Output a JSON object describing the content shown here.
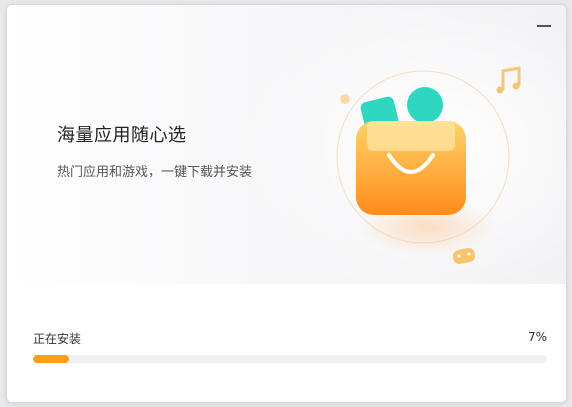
{
  "window": {
    "minimize_icon": "minimize-icon"
  },
  "hero": {
    "title": "海量应用随心选",
    "subtitle": "热门应用和游戏，一键下载并安装",
    "illustration_icons": [
      "shopping-bag-icon",
      "music-note-icon",
      "gamepad-icon"
    ]
  },
  "install": {
    "status": "正在安装",
    "percent_label": "7%",
    "progress": 0.07
  },
  "colors": {
    "accent": "#f5a017",
    "bag_top": "#ffd36a",
    "bag_bottom": "#ff8c1a",
    "teal": "#2fd6c0",
    "track": "#f0f0f2"
  }
}
